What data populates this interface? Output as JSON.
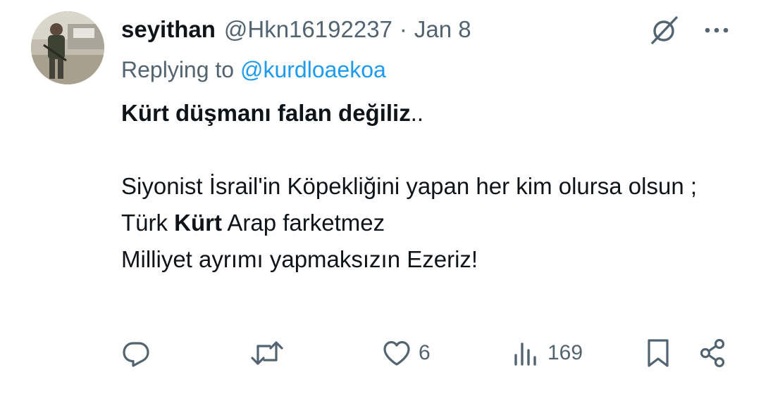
{
  "tweet": {
    "author": {
      "display_name": "seyithan",
      "handle": "@Hkn16192237"
    },
    "separator": "·",
    "date": "Jan 8",
    "replying_prefix": "Replying to ",
    "replying_to": "@kurdloaekoa",
    "line1_bold": "Kürt düşmanı falan değiliz",
    "line1_suffix": "..",
    "line2": "Siyonist İsrail'in Köpekliğini yapan her kim olursa olsun ;",
    "line3_prefix": "Türk ",
    "line3_bold": "Kürt",
    "line3_suffix": " Arap farketmez",
    "line4": "Milliyet ayrımı yapmaksızın Ezeriz!"
  },
  "actions": {
    "like_count": "6",
    "views_count": "169"
  },
  "colors": {
    "text": "#0f1419",
    "secondary": "#536471",
    "link": "#1d9bf0"
  },
  "icons": {
    "top": [
      "grok-icon",
      "more-icon"
    ],
    "actions": [
      "reply-icon",
      "retweet-icon",
      "like-icon",
      "views-icon",
      "bookmark-icon",
      "share-icon"
    ]
  }
}
